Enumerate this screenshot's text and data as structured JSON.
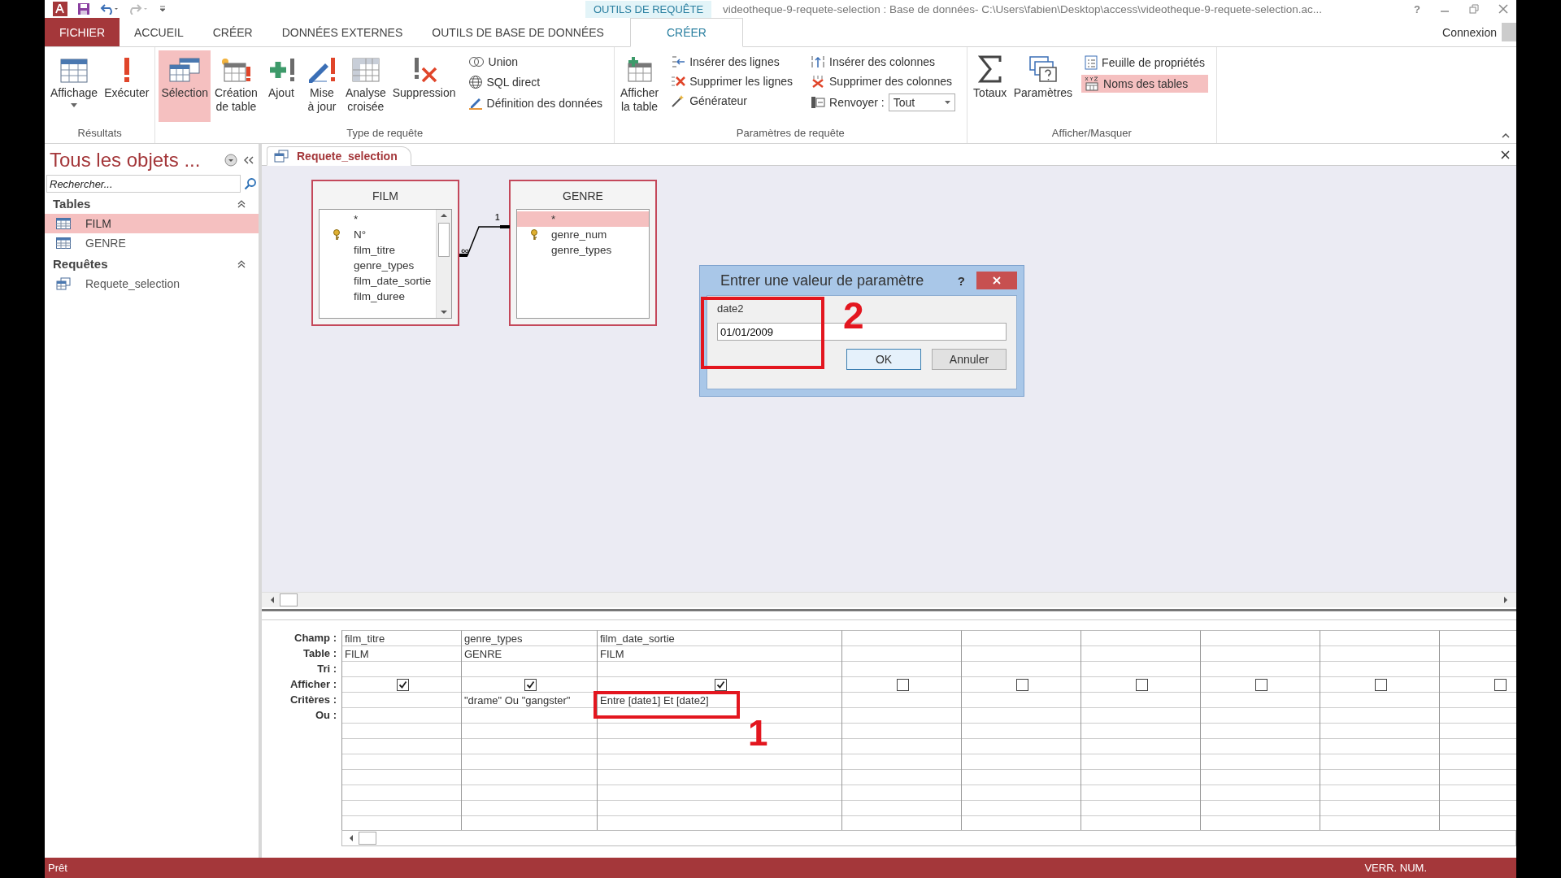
{
  "title_bar": {
    "context_label": "OUTILS DE REQUÊTE",
    "title": "videotheque-9-requete-selection : Base de données- C:\\Users\\fabien\\Desktop\\access\\videotheque-9-requete-selection.ac...",
    "help": "?"
  },
  "tabs": [
    {
      "label": "FICHIER",
      "kind": "file",
      "selected": false
    },
    {
      "label": "ACCUEIL",
      "kind": "normal",
      "selected": false
    },
    {
      "label": "CRÉER",
      "kind": "normal",
      "selected": false
    },
    {
      "label": "DONNÉES EXTERNES",
      "kind": "normal",
      "selected": false
    },
    {
      "label": "OUTILS DE BASE DE DONNÉES",
      "kind": "normal",
      "selected": false
    },
    {
      "label": "CRÉER",
      "kind": "context",
      "selected": true
    }
  ],
  "account": "Connexion",
  "ribbon": {
    "groups": [
      {
        "label": "Résultats",
        "items": [
          {
            "kind": "large",
            "label": "Affichage",
            "has_menu": true,
            "selected": false
          },
          {
            "kind": "large",
            "label": "Exécuter",
            "selected": false
          }
        ]
      },
      {
        "label": "Type de requête",
        "items": [
          {
            "kind": "large",
            "label": "Sélection",
            "selected": true
          },
          {
            "kind": "large",
            "label": "Création\nde table",
            "selected": false
          },
          {
            "kind": "large",
            "label": "Ajout",
            "selected": false
          },
          {
            "kind": "large",
            "label": "Mise\nà jour",
            "selected": false
          },
          {
            "kind": "large",
            "label": "Analyse\ncroisée",
            "selected": false
          },
          {
            "kind": "large",
            "label": "Suppression",
            "selected": false
          },
          {
            "kind": "column",
            "items": [
              {
                "kind": "small",
                "label": "Union",
                "selected": false
              },
              {
                "kind": "small",
                "label": "SQL direct",
                "selected": false
              },
              {
                "kind": "small",
                "label": "Définition des données",
                "selected": false
              }
            ]
          }
        ]
      },
      {
        "label": "Paramètres de requête",
        "items": [
          {
            "kind": "large",
            "label": "Afficher\nla table",
            "selected": false
          },
          {
            "kind": "column",
            "items": [
              {
                "kind": "small",
                "label": "Insérer des lignes",
                "selected": false
              },
              {
                "kind": "small",
                "label": "Supprimer les lignes",
                "selected": false
              },
              {
                "kind": "small",
                "label": "Générateur",
                "selected": false
              }
            ]
          },
          {
            "kind": "column",
            "items": [
              {
                "kind": "small",
                "label": "Insérer des colonnes",
                "selected": false
              },
              {
                "kind": "small",
                "label": "Supprimer des colonnes",
                "selected": false
              },
              {
                "kind": "combo",
                "label": "Renvoyer :",
                "value": "Tout"
              }
            ]
          }
        ]
      },
      {
        "label": "Afficher/Masquer",
        "items": [
          {
            "kind": "large",
            "label": "Totaux",
            "selected": false
          },
          {
            "kind": "large",
            "label": "Paramètres",
            "selected": false
          },
          {
            "kind": "column",
            "items": [
              {
                "kind": "small",
                "label": "Feuille de propriétés",
                "selected": false
              },
              {
                "kind": "small",
                "label": "Noms des tables",
                "selected": true
              }
            ]
          }
        ]
      }
    ]
  },
  "nav_pane": {
    "title": "Tous les objets ...",
    "search": {
      "placeholder": "Rechercher..."
    },
    "sections": [
      {
        "label": "Tables",
        "items": [
          {
            "label": "FILM",
            "kind": "table",
            "selected": true
          },
          {
            "label": "GENRE",
            "kind": "table",
            "selected": false
          }
        ]
      },
      {
        "label": "Requêtes",
        "items": [
          {
            "label": "Requete_selection",
            "kind": "query",
            "selected": false
          }
        ]
      }
    ]
  },
  "document_tab": {
    "label": "Requete_selection",
    "selected": true
  },
  "design": {
    "tables": [
      {
        "name": "FILM",
        "scrollbar": true,
        "fields": [
          {
            "label": "*",
            "key": false,
            "selected": false
          },
          {
            "label": "N°",
            "key": true,
            "selected": false
          },
          {
            "label": "film_titre",
            "key": false,
            "selected": false
          },
          {
            "label": "genre_types",
            "key": false,
            "selected": false
          },
          {
            "label": "film_date_sortie",
            "key": false,
            "selected": false
          },
          {
            "label": "film_duree",
            "key": false,
            "selected": false
          }
        ]
      },
      {
        "name": "GENRE",
        "scrollbar": false,
        "fields": [
          {
            "label": "*",
            "key": false,
            "selected": true
          },
          {
            "label": "genre_num",
            "key": true,
            "selected": false
          },
          {
            "label": "genre_types",
            "key": false,
            "selected": false
          }
        ]
      }
    ],
    "relationship": {
      "many": "∞",
      "one": "1"
    }
  },
  "dialog": {
    "title": "Entrer une valeur de paramètre",
    "help": "?",
    "label": "date2",
    "value": "01/01/2009",
    "buttons": [
      "OK",
      "Annuler"
    ],
    "annotation": "2"
  },
  "grid": {
    "row_headers": [
      "Champ :",
      "Table :",
      "Tri :",
      "Afficher :",
      "Critères :",
      "Ou :"
    ],
    "columns": [
      {
        "field": "film_titre",
        "table": "FILM",
        "show": true
      },
      {
        "field": "genre_types",
        "table": "GENRE",
        "show": true,
        "criteria": "\"drame\" Ou \"gangster\""
      },
      {
        "field": "film_date_sortie",
        "table": "FILM",
        "show": true,
        "criteria": "Entre [date1] Et [date2]"
      },
      {
        "show": false
      },
      {
        "show": false
      },
      {
        "show": false
      },
      {
        "show": false
      },
      {
        "show": false
      },
      {
        "show": false
      }
    ],
    "annotation": "1"
  },
  "status_bar": {
    "left": "Prêt",
    "right": "VERR. NUM."
  }
}
